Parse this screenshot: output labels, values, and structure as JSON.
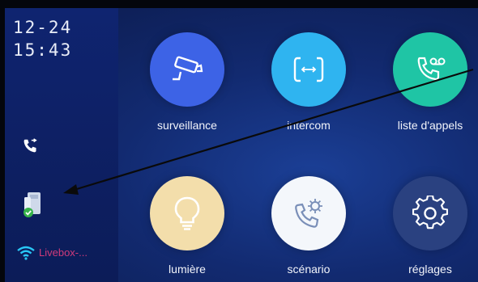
{
  "status": {
    "date": "12-24",
    "time": "15:43",
    "wifi_name": "Livebox-..."
  },
  "sidebar_icons": [
    {
      "icon": "phone-handset-icon",
      "description": "call"
    },
    {
      "icon": "device-check-icon",
      "description": "device"
    },
    {
      "icon": "wifi-icon",
      "description": "wifi"
    }
  ],
  "menu": [
    {
      "label": "surveillance",
      "icon": "camera-icon",
      "color": "#3d63e6"
    },
    {
      "label": "intercom",
      "icon": "intercom-icon",
      "color": "#2fb4f0"
    },
    {
      "label": "liste d'appels",
      "icon": "voicemail-icon",
      "color": "#1fc5a5"
    },
    {
      "label": "lumière",
      "icon": "lightbulb-icon",
      "color": "#f3deab"
    },
    {
      "label": "scénario",
      "icon": "scenario-phone-icon",
      "color": "#f4f7fb"
    },
    {
      "label": "réglages",
      "icon": "gear-icon",
      "color": "#2a4180"
    }
  ],
  "colors": {
    "background": "#122a70",
    "sidebar": "#0f2470",
    "wifi_label": "#d03a7a"
  }
}
